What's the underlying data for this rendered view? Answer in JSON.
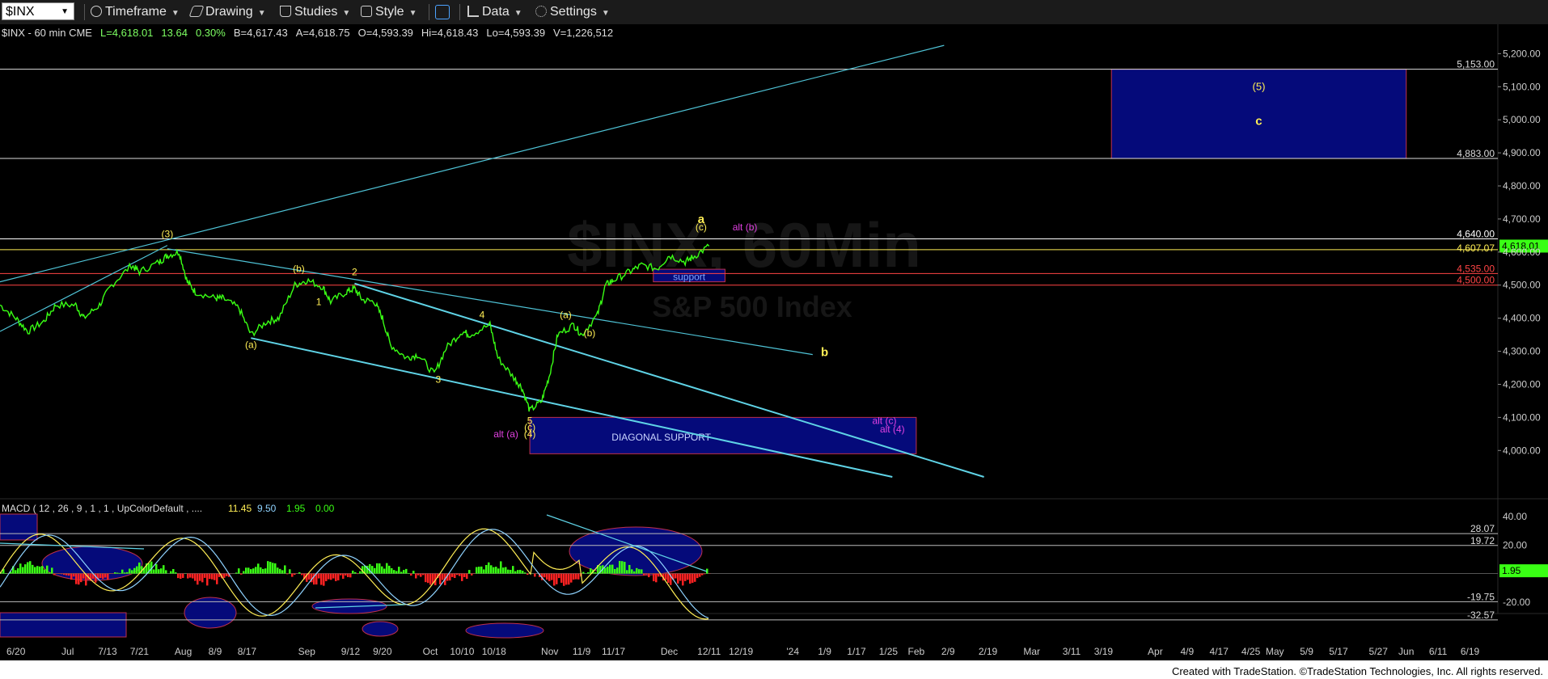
{
  "toolbar": {
    "symbol": "$INX",
    "timeframe": "Timeframe",
    "drawing": "Drawing",
    "studies": "Studies",
    "style": "Style",
    "data": "Data",
    "settings": "Settings"
  },
  "quote": {
    "name": "$INX - 60 min  CME",
    "last": "L=4,618.01",
    "change": "13.64",
    "pct": "0.30%",
    "bid": "B=4,617.43",
    "ask": "A=4,618.75",
    "open": "O=4,593.39",
    "high": "Hi=4,618.43",
    "low": "Lo=4,593.39",
    "volume": "V=1,226,512"
  },
  "watermark": {
    "title": "$INX, 60Min",
    "subtitle": "S&P 500 Index"
  },
  "colors": {
    "bg": "#000000",
    "price": "#39ff14",
    "cyan": "#5fd3e6",
    "yellow": "#ffee55",
    "red": "#ff4444",
    "magenta": "#e040e0",
    "navy": "#050a7a",
    "white_line": "#dddddd"
  },
  "chart_data": [
    {
      "type": "line",
      "panel": "price",
      "ylim": [
        3920,
        5240
      ],
      "yticks": [
        "5,200.00",
        "5,100.00",
        "5,000.00",
        "4,900.00",
        "4,800.00",
        "4,700.00",
        "4,600.00",
        "4,500.00",
        "4,400.00",
        "4,300.00",
        "4,200.00",
        "4,100.00",
        "4,000.00"
      ],
      "x_ticks": [
        "6/20",
        "Jul",
        "7/13",
        "7/21",
        "Aug",
        "8/9",
        "8/17",
        "Sep",
        "9/12",
        "9/20",
        "Oct",
        "10/10",
        "10/18",
        "Nov",
        "11/9",
        "11/17",
        "Dec",
        "12/11",
        "12/19",
        "'24",
        "1/9",
        "1/17",
        "1/25",
        "Feb",
        "2/9",
        "2/19",
        "Mar",
        "3/11",
        "3/19",
        "Apr",
        "4/9",
        "4/17",
        "4/25",
        "May",
        "5/9",
        "5/17",
        "5/27",
        "Jun",
        "6/11",
        "6/19"
      ],
      "x_range": [
        "2023-06-16",
        "2024-06-26"
      ],
      "price_series": [
        [
          "2023-06-16",
          4440
        ],
        [
          "2023-06-20",
          4400
        ],
        [
          "2023-06-23",
          4360
        ],
        [
          "2023-06-27",
          4390
        ],
        [
          "2023-06-30",
          4440
        ],
        [
          "2023-07-05",
          4440
        ],
        [
          "2023-07-07",
          4400
        ],
        [
          "2023-07-11",
          4440
        ],
        [
          "2023-07-14",
          4500
        ],
        [
          "2023-07-19",
          4560
        ],
        [
          "2023-07-21",
          4540
        ],
        [
          "2023-07-26",
          4570
        ],
        [
          "2023-07-28",
          4590
        ],
        [
          "2023-07-31",
          4600
        ],
        [
          "2023-08-02",
          4510
        ],
        [
          "2023-08-04",
          4480
        ],
        [
          "2023-08-09",
          4460
        ],
        [
          "2023-08-11",
          4460
        ],
        [
          "2023-08-15",
          4430
        ],
        [
          "2023-08-18",
          4350
        ],
        [
          "2023-08-22",
          4390
        ],
        [
          "2023-08-25",
          4400
        ],
        [
          "2023-08-29",
          4500
        ],
        [
          "2023-09-01",
          4515
        ],
        [
          "2023-09-05",
          4495
        ],
        [
          "2023-09-07",
          4450
        ],
        [
          "2023-09-11",
          4480
        ],
        [
          "2023-09-13",
          4490
        ],
        [
          "2023-09-15",
          4455
        ],
        [
          "2023-09-18",
          4450
        ],
        [
          "2023-09-20",
          4400
        ],
        [
          "2023-09-22",
          4320
        ],
        [
          "2023-09-26",
          4280
        ],
        [
          "2023-09-29",
          4290
        ],
        [
          "2023-10-03",
          4230
        ],
        [
          "2023-10-06",
          4310
        ],
        [
          "2023-10-10",
          4360
        ],
        [
          "2023-10-12",
          4350
        ],
        [
          "2023-10-17",
          4380
        ],
        [
          "2023-10-19",
          4280
        ],
        [
          "2023-10-23",
          4220
        ],
        [
          "2023-10-25",
          4190
        ],
        [
          "2023-10-27",
          4120
        ],
        [
          "2023-10-30",
          4150
        ],
        [
          "2023-11-01",
          4230
        ],
        [
          "2023-11-03",
          4350
        ],
        [
          "2023-11-07",
          4380
        ],
        [
          "2023-11-09",
          4350
        ],
        [
          "2023-11-13",
          4410
        ],
        [
          "2023-11-15",
          4500
        ],
        [
          "2023-11-17",
          4515
        ],
        [
          "2023-11-21",
          4540
        ],
        [
          "2023-11-24",
          4560
        ],
        [
          "2023-11-28",
          4550
        ],
        [
          "2023-12-01",
          4590
        ],
        [
          "2023-12-05",
          4570
        ],
        [
          "2023-12-07",
          4585
        ],
        [
          "2023-12-11",
          4618
        ]
      ],
      "levels": [
        {
          "value": 5153.0,
          "label": "5,153.00"
        },
        {
          "value": 4883.0,
          "label": "4,883.00"
        },
        {
          "value": 4640.0,
          "label": "4,640.00"
        },
        {
          "value": 4607.07,
          "label": "4,607.07"
        },
        {
          "value": 4535.0,
          "label": "4,535.00"
        },
        {
          "value": 4500.0,
          "label": "4,500.00"
        }
      ],
      "last_price": "4,618.01",
      "boxes": [
        {
          "label": "(5)",
          "sublabel": "c"
        },
        {
          "label": "support"
        },
        {
          "label": "DIAGONAL SUPPORT"
        }
      ],
      "wave_labels": [
        "(3)",
        "(b)",
        "2",
        "1",
        "(a)",
        "4",
        "3",
        "5",
        "(c)",
        "(4)",
        "alt (a)",
        "(a)",
        "(b)",
        "a",
        "(c)",
        "alt (b)",
        "b",
        "alt (c)",
        "alt (4)"
      ]
    },
    {
      "type": "line",
      "panel": "macd",
      "title": "MACD ( 12 , 26 , 9 , 1 , 1 , UpColorDefault , ....",
      "values_label": [
        "11.45",
        "9.50",
        "1.95",
        "0.00"
      ],
      "ylim": [
        -40,
        48
      ],
      "yticks": [
        "40.00",
        "20.00",
        "-20.00"
      ],
      "levels": [
        {
          "value": 28.07,
          "label": "28.07"
        },
        {
          "value": 19.72,
          "label": "19.72"
        },
        {
          "value": -19.75,
          "label": "-19.75"
        },
        {
          "value": -32.57,
          "label": "-32.57"
        }
      ],
      "last_value": "1.95"
    }
  ],
  "footer": "Created with TradeStation. ©TradeStation Technologies, Inc. All rights reserved."
}
